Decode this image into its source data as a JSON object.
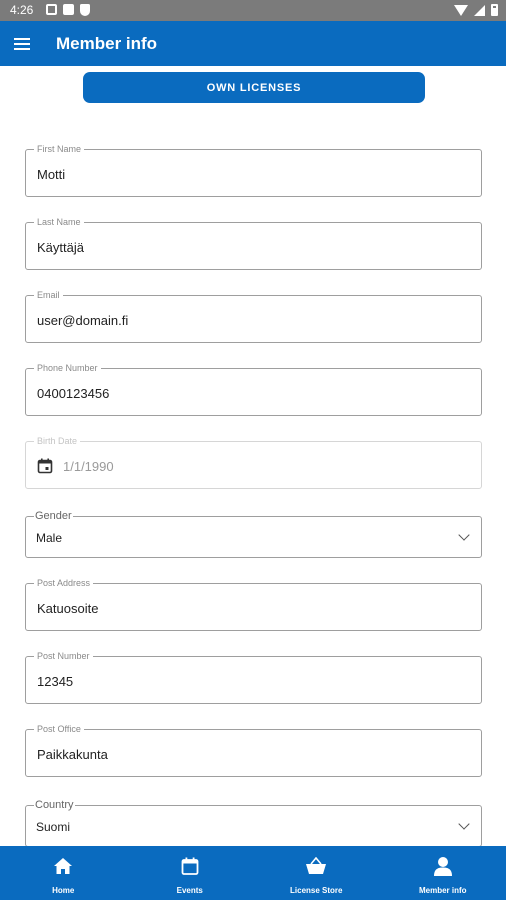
{
  "status_bar": {
    "time": "4:26"
  },
  "app_bar": {
    "title": "Member info"
  },
  "own_licenses_label": "OWN LICENSES",
  "fields": {
    "first_name": {
      "label": "First Name",
      "value": "Motti"
    },
    "last_name": {
      "label": "Last Name",
      "value": "Käyttäjä"
    },
    "email": {
      "label": "Email",
      "value": "user@domain.fi"
    },
    "phone": {
      "label": "Phone Number",
      "value": "0400123456"
    },
    "birth_date": {
      "label": "Birth Date",
      "value": "1/1/1990"
    },
    "gender": {
      "label": "Gender",
      "value": "Male"
    },
    "post_address": {
      "label": "Post Address",
      "value": "Katuosoite"
    },
    "post_number": {
      "label": "Post Number",
      "value": "12345"
    },
    "post_office": {
      "label": "Post Office",
      "value": "Paikkakunta"
    },
    "country": {
      "label": "Country",
      "value": "Suomi"
    }
  },
  "bottom_nav": [
    {
      "label": "Home",
      "icon": "home-icon"
    },
    {
      "label": "Events",
      "icon": "calendar-icon"
    },
    {
      "label": "License Store",
      "icon": "basket-icon"
    },
    {
      "label": "Member info",
      "icon": "person-icon"
    }
  ],
  "colors": {
    "primary": "#0a6bbf",
    "status_bar": "#7b7b7b"
  }
}
